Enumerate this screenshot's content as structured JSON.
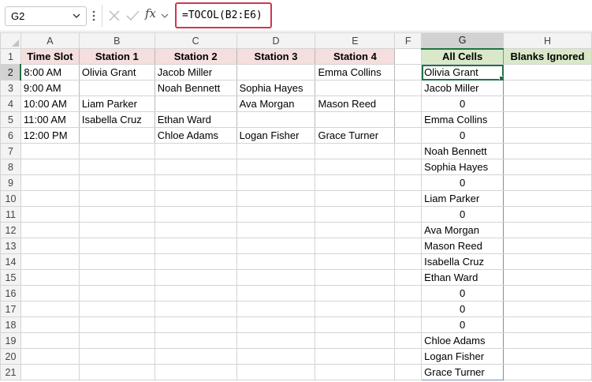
{
  "name_box": {
    "value": "G2"
  },
  "formula_bar": {
    "fx_label": "fx",
    "formula": "=TOCOL(B2:E6)"
  },
  "columns": [
    "A",
    "B",
    "C",
    "D",
    "E",
    "F",
    "G",
    "H"
  ],
  "rows": [
    "1",
    "2",
    "3",
    "4",
    "5",
    "6",
    "7",
    "8",
    "9",
    "10",
    "11",
    "12",
    "13",
    "14",
    "15",
    "16",
    "17",
    "18",
    "19",
    "20",
    "21"
  ],
  "selected_cell": "G2",
  "colors": {
    "header_pink": "#f4dede",
    "header_green": "#d9e8c8",
    "accent_green": "#217346",
    "formula_highlight": "#d0364e",
    "spill_border": "#6f8fc1"
  },
  "table": {
    "headers": [
      "Time Slot",
      "Station 1",
      "Station 2",
      "Station 3",
      "Station 4"
    ],
    "rows": [
      [
        "8:00 AM",
        "Olivia Grant",
        "Jacob Miller",
        "",
        "Emma Collins"
      ],
      [
        "9:00 AM",
        "",
        "Noah Bennett",
        "Sophia Hayes",
        ""
      ],
      [
        "10:00 AM",
        "Liam Parker",
        "",
        "Ava Morgan",
        "Mason Reed"
      ],
      [
        "11:00 AM",
        "Isabella Cruz",
        "Ethan Ward",
        "",
        ""
      ],
      [
        "12:00 PM",
        "",
        "Chloe Adams",
        "Logan Fisher",
        "Grace Turner"
      ]
    ]
  },
  "results": {
    "all_cells_header": "All Cells",
    "blanks_ignored_header": "Blanks Ignored",
    "all_cells": [
      "Olivia Grant",
      "Jacob Miller",
      "0",
      "Emma Collins",
      "0",
      "Noah Bennett",
      "Sophia Hayes",
      "0",
      "Liam Parker",
      "0",
      "Ava Morgan",
      "Mason Reed",
      "Isabella Cruz",
      "Ethan Ward",
      "0",
      "0",
      "0",
      "Chloe Adams",
      "Logan Fisher",
      "Grace Turner"
    ]
  }
}
